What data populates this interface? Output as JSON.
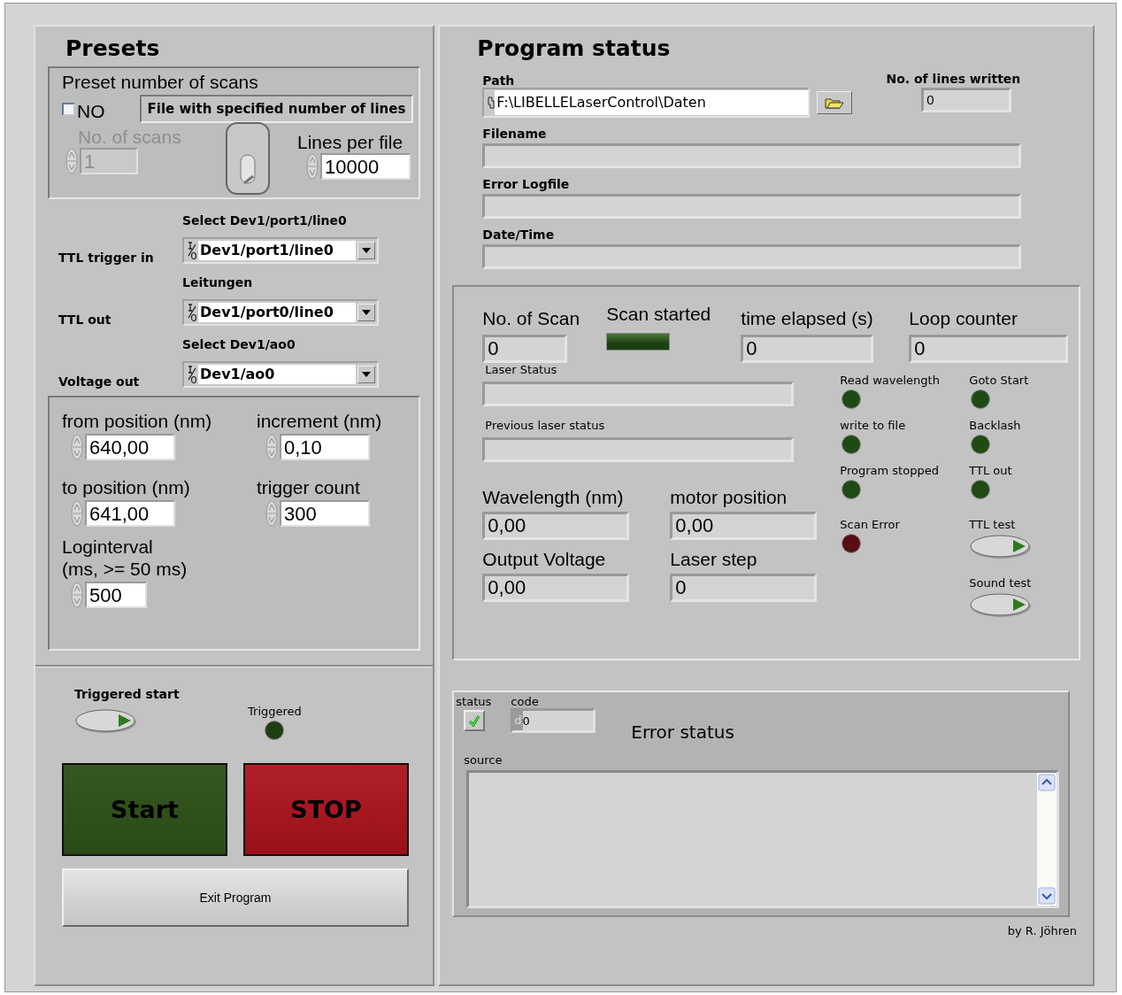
{
  "presets": {
    "title": "Presets",
    "scan_preset": {
      "title": "Preset number of scans",
      "checkbox": {
        "label": "NO",
        "checked": false
      },
      "mode": "File with specified number of lines",
      "scans": {
        "label": "No. of scans",
        "value": "1",
        "disabled": true
      },
      "switch": {
        "on": false
      },
      "lines_per_file": {
        "label": "Lines per file",
        "value": "10000"
      }
    },
    "io_lines": [
      {
        "name": "TTL trigger in",
        "caption": "Select Dev1/port1/line0",
        "value": "Dev1/port1/line0"
      },
      {
        "name": "TTL out",
        "caption": "Leitungen",
        "value": "Dev1/port0/line0"
      },
      {
        "name": "Voltage out",
        "caption": "Select Dev1/ao0",
        "value": "Dev1/ao0"
      }
    ],
    "scan_params": [
      {
        "label": "from position (nm)",
        "value": "640,00"
      },
      {
        "label": "increment (nm)",
        "value": "0,10"
      },
      {
        "label": "to position (nm)",
        "value": "641,00"
      },
      {
        "label": "trigger count",
        "value": "300"
      },
      {
        "label": "Loginterval\n(ms, >= 50 ms)",
        "value": "500"
      }
    ],
    "triggered_start": {
      "label": "Triggered start",
      "on": false
    },
    "triggered": {
      "label": "Triggered",
      "on": false,
      "color": "#1f3d12"
    },
    "buttons": [
      {
        "label": "Start",
        "kind": "start"
      },
      {
        "label": "STOP",
        "kind": "stop"
      },
      {
        "label": "Exit Program",
        "kind": "exit"
      }
    ]
  },
  "program_status": {
    "title": "Program status",
    "path": {
      "label": "Path",
      "value": "F:\\LIBELLELaserControl\\Daten"
    },
    "lines_written": {
      "label": "No. of lines written",
      "value": "0"
    },
    "files": [
      {
        "label": "Filename"
      },
      {
        "label": "Error Logfile"
      },
      {
        "label": "Date/Time"
      }
    ],
    "scan": {
      "no_of_scan": {
        "label": "No. of Scan",
        "value": "0"
      },
      "scan_started": {
        "label": "Scan started",
        "on": false
      },
      "time_elapsed": {
        "label": "time elapsed (s)",
        "value": "0"
      },
      "loop_counter": {
        "label": "Loop counter",
        "value": "0"
      },
      "laser_status": [
        {
          "label": "Laser Status"
        },
        {
          "label": "Previous laser status"
        }
      ],
      "readouts": [
        {
          "label": "Wavelength (nm)",
          "value": "0,00"
        },
        {
          "label": "motor position",
          "value": "0,00"
        },
        {
          "label": "Output Voltage",
          "value": "0,00"
        },
        {
          "label": "Laser step",
          "value": "0"
        }
      ],
      "light_columns": [
        [
          {
            "kind": "led",
            "label": "Read wavelength",
            "on": false,
            "color": "#1f4a14"
          },
          {
            "kind": "led",
            "label": "write to file",
            "on": false,
            "color": "#1f4a14"
          },
          {
            "kind": "led",
            "label": "Program stopped",
            "on": false,
            "color": "#1f4a14"
          },
          {
            "kind": "led",
            "label": "Scan Error",
            "on": false,
            "color": "#5a0d14"
          }
        ],
        [
          {
            "kind": "led",
            "label": "Goto Start",
            "on": false,
            "color": "#1f4a14"
          },
          {
            "kind": "led",
            "label": "Backlash",
            "on": false,
            "color": "#1f4a14"
          },
          {
            "kind": "led",
            "label": "TTL out",
            "on": false,
            "color": "#1f4a14"
          },
          {
            "kind": "button",
            "label": "TTL test",
            "on": false
          },
          {
            "kind": "button",
            "label": "Sound test",
            "on": false
          }
        ]
      ]
    },
    "error": {
      "status": {
        "label": "status",
        "checked": true
      },
      "code": {
        "label": "code",
        "radix": "d",
        "value": "0"
      },
      "title": "Error status",
      "source": {
        "label": "source"
      }
    },
    "credit": "by R. Jöhren"
  }
}
